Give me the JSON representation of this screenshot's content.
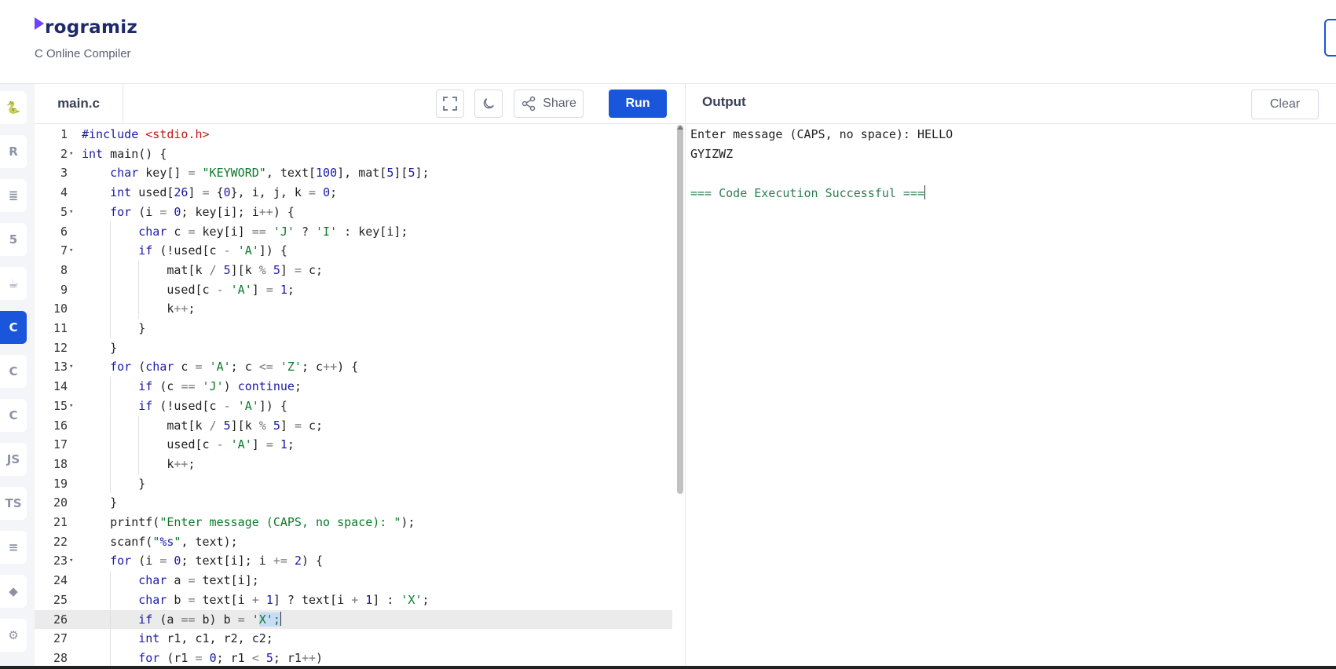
{
  "header": {
    "logo_text": "rogramiz",
    "subtitle": "C Online Compiler"
  },
  "sidebar": {
    "items": [
      {
        "name": "python",
        "label": "🐍"
      },
      {
        "name": "r",
        "label": "R"
      },
      {
        "name": "sql",
        "label": "≣"
      },
      {
        "name": "html",
        "label": "5"
      },
      {
        "name": "java",
        "label": "☕"
      },
      {
        "name": "c",
        "label": "C",
        "active": true
      },
      {
        "name": "cpp",
        "label": "C"
      },
      {
        "name": "csharp",
        "label": "C"
      },
      {
        "name": "js",
        "label": "JS"
      },
      {
        "name": "ts",
        "label": "TS"
      },
      {
        "name": "go",
        "label": "≡"
      },
      {
        "name": "swift",
        "label": "◆"
      },
      {
        "name": "rust",
        "label": "⚙"
      }
    ]
  },
  "editor": {
    "file_tab": "main.c",
    "share_label": "Share",
    "run_label": "Run",
    "active_line": 26,
    "lines": [
      "#include <stdio.h>",
      "int main() {",
      "    char key[] = \"KEYWORD\", text[100], mat[5][5];",
      "    int used[26] = {0}, i, j, k = 0;",
      "    for (i = 0; key[i]; i++) {",
      "        char c = key[i] == 'J' ? 'I' : key[i];",
      "        if (!used[c - 'A']) {",
      "            mat[k / 5][k % 5] = c;",
      "            used[c - 'A'] = 1;",
      "            k++;",
      "        }",
      "    }",
      "    for (char c = 'A'; c <= 'Z'; c++) {",
      "        if (c == 'J') continue;",
      "        if (!used[c - 'A']) {",
      "            mat[k / 5][k % 5] = c;",
      "            used[c - 'A'] = 1;",
      "            k++;",
      "        }",
      "    }",
      "    printf(\"Enter message (CAPS, no space): \");",
      "    scanf(\"%s\", text);",
      "    for (i = 0; text[i]; i += 2) {",
      "        char a = text[i];",
      "        char b = text[i + 1] ? text[i + 1] : 'X';",
      "        if (a == b) b = 'X';",
      "        int r1, c1, r2, c2;",
      "        for (r1 = 0; r1 < 5; r1++)"
    ],
    "fold_lines": [
      2,
      5,
      7,
      13,
      15,
      23
    ]
  },
  "output": {
    "title": "Output",
    "clear_label": "Clear",
    "lines": [
      "Enter message (CAPS, no space): HELLO",
      "GYIZWZ",
      "",
      "=== Code Execution Successful ==="
    ]
  }
}
